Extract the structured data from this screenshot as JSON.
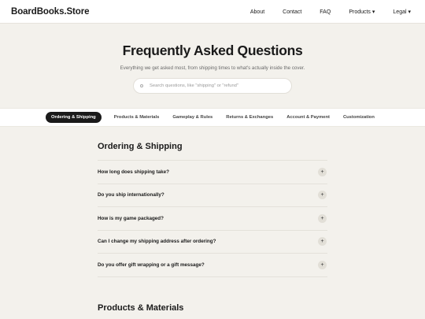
{
  "header": {
    "brand": "BoardBooks.Store",
    "nav": [
      {
        "label": "About"
      },
      {
        "label": "Contact"
      },
      {
        "label": "FAQ"
      },
      {
        "label": "Products ▾"
      },
      {
        "label": "Legal ▾"
      }
    ]
  },
  "hero": {
    "title": "Frequently Asked Questions",
    "subtitle": "Everything we get asked most, from shipping times to what's actually inside the cover.",
    "search_placeholder": "Search questions, like \"shipping\" or \"refund\""
  },
  "tabs": [
    {
      "label": "Ordering & Shipping",
      "active": true
    },
    {
      "label": "Products & Materials"
    },
    {
      "label": "Gameplay & Rules"
    },
    {
      "label": "Returns & Exchanges"
    },
    {
      "label": "Account & Payment"
    },
    {
      "label": "Customization"
    }
  ],
  "sections": [
    {
      "title": "Ordering & Shipping",
      "questions": [
        {
          "q": "How long does shipping take?"
        },
        {
          "q": "Do you ship internationally?"
        },
        {
          "q": "How is my game packaged?"
        },
        {
          "q": "Can I change my shipping address after ordering?"
        },
        {
          "q": "Do you offer gift wrapping or a gift message?"
        }
      ]
    },
    {
      "title": "Products & Materials"
    }
  ],
  "icons": {
    "expand": "+",
    "search": "search-icon"
  }
}
